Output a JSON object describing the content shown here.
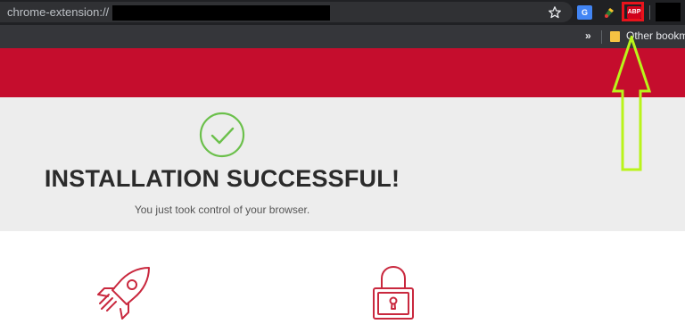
{
  "browser": {
    "url_prefix": "chrome-extension://",
    "extensions": {
      "translate_label": "G",
      "abp_label": "ABP"
    },
    "bookmarks": {
      "more_chevron": "»",
      "other_bookmarks": "Other bookma"
    }
  },
  "page": {
    "banner_color": "#c50d2d",
    "success": {
      "title": "INSTALLATION SUCCESSFUL!",
      "subtitle": "You just took control of your browser."
    },
    "icons": [
      "check-circle-icon",
      "rocket-icon",
      "lock-icon"
    ]
  },
  "annotation": {
    "arrow_color": "#b9f41a",
    "highlight_color": "#e8141c"
  }
}
